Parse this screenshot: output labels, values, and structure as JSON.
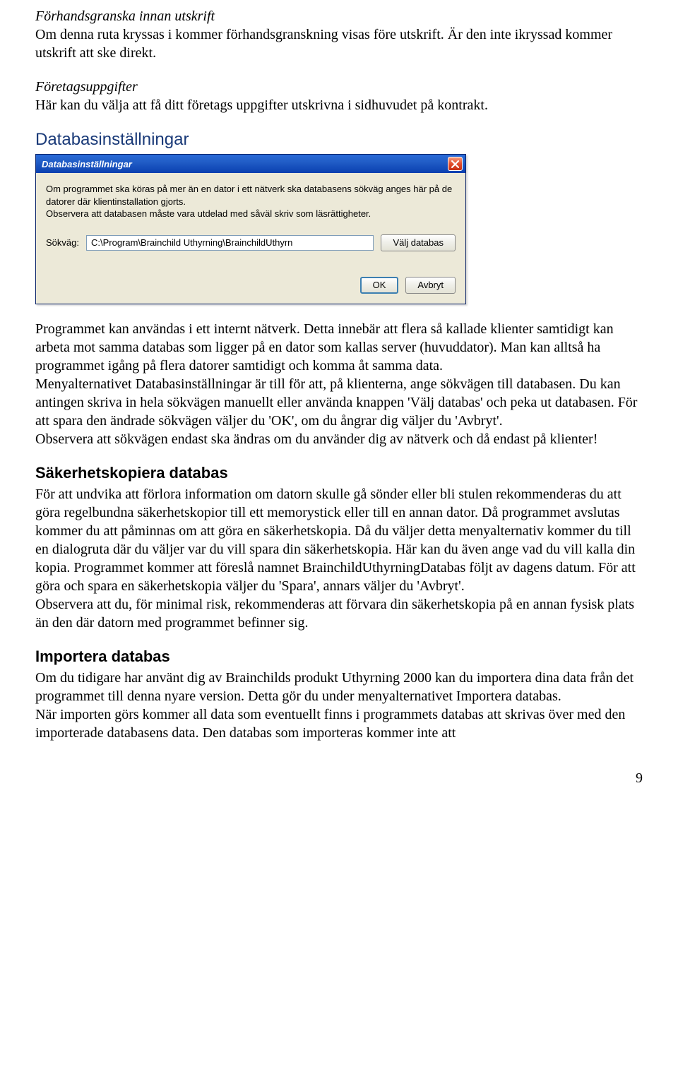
{
  "s1": {
    "head": "Förhandsgranska innan utskrift",
    "body": "Om denna ruta kryssas i kommer förhandsgranskning visas före utskrift. Är den inte ikryssad kommer utskrift att ske direkt."
  },
  "s2": {
    "head": "Företagsuppgifter",
    "body": "Här kan du välja att få ditt företags uppgifter utskrivna i sidhuvudet på kontrakt."
  },
  "h_db": "Databasinställningar",
  "dialog": {
    "title": "Databasinställningar",
    "info1": "Om programmet ska köras på mer än en dator i ett nätverk ska databasens sökväg anges här på de datorer där klientinstallation gjorts.",
    "info2": "Observera att databasen måste vara utdelad med såväl skriv som läsrättigheter.",
    "path_label": "Sökväg:",
    "path_value": "C:\\Program\\Brainchild Uthyrning\\BrainchildUthyrn",
    "choose_btn": "Välj databas",
    "ok": "OK",
    "cancel": "Avbryt"
  },
  "db_para1": "Programmet kan användas i ett internt nätverk. Detta innebär att flera så kallade klienter samtidigt kan arbeta mot samma databas som ligger på en dator som kallas server (huvuddator). Man kan alltså ha programmet igång på flera datorer samtidigt och komma åt samma data.",
  "db_para2": "Menyalternativet Databasinställningar är till för att, på klienterna, ange sökvägen till databasen. Du kan antingen skriva in hela sökvägen manuellt eller använda knappen 'Välj databas' och peka ut databasen. För att spara den ändrade sökvägen väljer du 'OK', om du ångrar dig väljer du 'Avbryt'.",
  "db_para3": "Observera att sökvägen endast ska ändras om du använder dig av nätverk och då endast på klienter!",
  "h_backup": "Säkerhetskopiera databas",
  "backup_para1": "För att undvika att förlora information om datorn skulle gå sönder eller bli stulen rekommenderas du att göra regelbundna säkerhetskopior till ett memorystick eller till en annan dator. Då programmet avslutas kommer du att påminnas om att göra en säkerhetskopia. Då du väljer detta menyalternativ kommer du till en dialogruta där du väljer var du vill spara din säkerhetskopia. Här kan du även ange vad du vill kalla din kopia. Programmet kommer att föreslå namnet BrainchildUthyrningDatabas följt av dagens datum. För att göra och spara en säkerhetskopia väljer du 'Spara', annars väljer du 'Avbryt'.",
  "backup_para2": "Observera att du, för minimal risk, rekommenderas att förvara din säkerhetskopia på en annan fysisk plats än den där datorn med programmet befinner sig.",
  "h_import": "Importera databas",
  "import_para1": "Om du tidigare har använt dig av Brainchilds produkt Uthyrning 2000 kan du importera dina data från det programmet till denna nyare version. Detta gör du under menyalternativet Importera databas.",
  "import_para2": "När importen görs kommer all data som eventuellt finns i programmets databas att skrivas över med den importerade databasens data. Den databas som importeras kommer inte att",
  "page_num": "9"
}
